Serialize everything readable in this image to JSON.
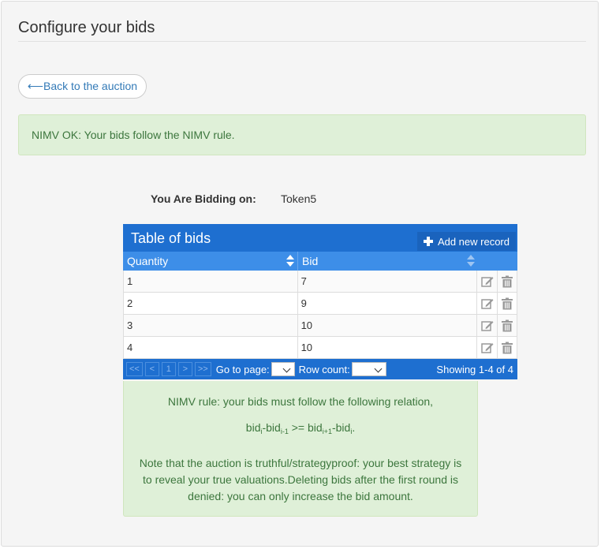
{
  "page": {
    "title": "Configure your bids",
    "back_label": "⟵Back to the auction",
    "alert": "NIMV OK: Your bids follow the NIMV rule.",
    "bidding_label": "You Are Bidding on:",
    "bidding_value": "Token5"
  },
  "table": {
    "title": "Table of bids",
    "add_label": "Add new record",
    "columns": [
      "Quantity",
      "Bid"
    ],
    "rows": [
      {
        "quantity": "1",
        "bid": "7"
      },
      {
        "quantity": "2",
        "bid": "9"
      },
      {
        "quantity": "3",
        "bid": "10"
      },
      {
        "quantity": "4",
        "bid": "10"
      }
    ],
    "pager": {
      "buttons": [
        "<<",
        "<",
        "1",
        ">",
        ">>"
      ],
      "goto_label": "Go to page:",
      "rowcount_label": "Row count:",
      "showing": "Showing 1-4 of 4"
    }
  },
  "note": {
    "line1": "NIMV rule: your bids must follow the following relation,",
    "formula": {
      "p1": "bid",
      "s1": "i",
      "p2": "-bid",
      "s2": "i-1",
      "p3": " >= bid",
      "s3": "i+1",
      "p4": "-bid",
      "s4": "i",
      "p5": "."
    },
    "line3": "Note that the auction is truthful/strategyproof: your best strategy is to reveal your true valuations.Deleting bids after the first round is denied: you can only increase the bid amount."
  },
  "colors": {
    "header_blue": "#1e6fd0",
    "column_blue": "#3d8ee8",
    "success_bg": "#dff0d8",
    "success_text": "#3c763d",
    "link": "#337ab7"
  },
  "icons": {
    "edit": "edit-icon",
    "delete": "trash-icon",
    "add": "plus-icon",
    "sort": "sort-icon"
  }
}
